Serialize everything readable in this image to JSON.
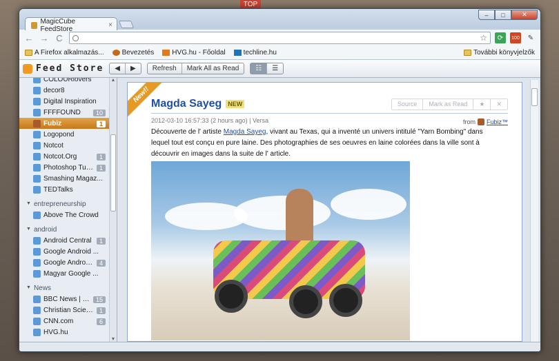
{
  "browser": {
    "tab_title": "MagicCube FeedStore",
    "tab_close": "×",
    "window_controls": {
      "minimize": "–",
      "maximize": "□",
      "close": "✕"
    },
    "address": "",
    "nav": {
      "back": "←",
      "forward": "→",
      "reload": "C"
    },
    "star": "☆",
    "extension_badge": "100",
    "wrench": "🔧",
    "background_tab_text": "TOP"
  },
  "bookmarks": {
    "items": [
      {
        "label": "A Firefox alkalmazás...",
        "icon": "folder-icon"
      },
      {
        "label": "Bevezetés",
        "icon": "firefox-icon"
      },
      {
        "label": "HVG.hu - Főoldal",
        "icon": "hvg-icon"
      },
      {
        "label": "techline.hu",
        "icon": "techline-icon"
      }
    ],
    "other": "További könyvjelzők"
  },
  "app": {
    "logo": "Feed Store",
    "nav_prev": "◀",
    "nav_next": "▶",
    "refresh": "Refresh",
    "mark_all": "Mark All as Read",
    "view_list": "☷",
    "view_full": "☰"
  },
  "sidebar": {
    "groups": [
      {
        "category": "",
        "feeds": [
          {
            "name": "COLOURlovers",
            "count": ""
          },
          {
            "name": "decor8",
            "count": ""
          },
          {
            "name": "Digital Inspiration",
            "count": ""
          },
          {
            "name": "FFFFOUND",
            "count": "10"
          },
          {
            "name": "Fubiz",
            "count": "1",
            "selected": true
          },
          {
            "name": "Logopond",
            "count": ""
          },
          {
            "name": "Notcot",
            "count": ""
          },
          {
            "name": "Notcot.Org",
            "count": "1"
          },
          {
            "name": "Photoshop Tutori...",
            "count": "1"
          },
          {
            "name": "Smashing Magaz...",
            "count": ""
          },
          {
            "name": "TEDTalks",
            "count": ""
          }
        ]
      },
      {
        "category": "entrepreneurship",
        "feeds": [
          {
            "name": "Above The Crowd",
            "count": ""
          }
        ]
      },
      {
        "category": "android",
        "feeds": [
          {
            "name": "Android Central",
            "count": "1"
          },
          {
            "name": "Google Android ...",
            "count": ""
          },
          {
            "name": "Google Android ...",
            "count": "4"
          },
          {
            "name": "Magyar Google ...",
            "count": ""
          }
        ]
      },
      {
        "category": "News",
        "feeds": [
          {
            "name": "BBC News | New...",
            "count": "15"
          },
          {
            "name": "Christian Science ...",
            "count": "1"
          },
          {
            "name": "CNN.com",
            "count": "6"
          },
          {
            "name": "HVG.hu",
            "count": ""
          }
        ]
      }
    ]
  },
  "article": {
    "ribbon": "New!!",
    "title": "Magda Sayeg",
    "new_badge": "NEW",
    "actions": {
      "source": "Source",
      "mark_read": "Mark as Read",
      "star": "★",
      "close": "✕"
    },
    "meta": "2012-03-10 16:57:33 (2 hours ago) | Versa",
    "from_label": "from",
    "from_source": "Fubiz™",
    "body_before": "Découverte de l'  artiste ",
    "body_link": "Magda Sayeg",
    "body_after": ", vivant au Texas, qui a inventé un univers intitulé  \"Yarn Bombing\"  dans lequel tout est conçu en pure laine. Des photographies de ses oeuvres en laine colorées dans la ville sont à découvrir en images dans la suite de l'  article."
  }
}
